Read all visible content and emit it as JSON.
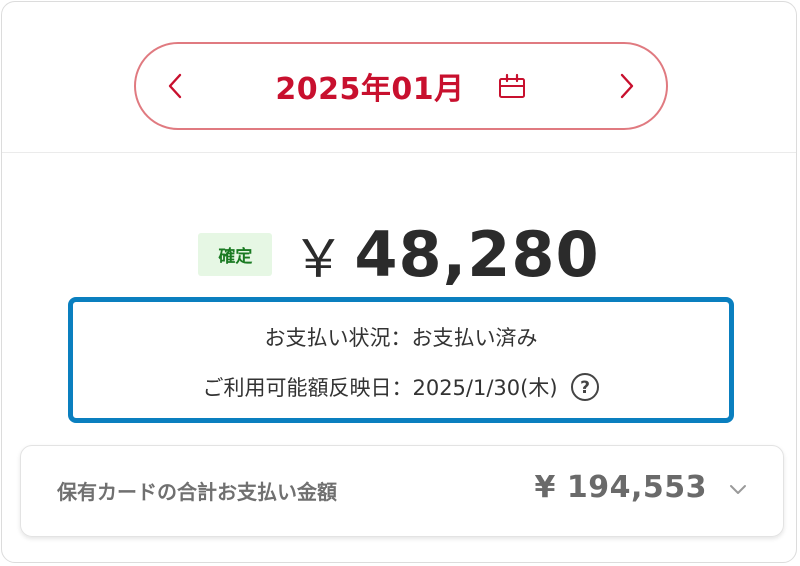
{
  "month_selector": {
    "label": "2025年01月",
    "prev_icon": "chevron-left-icon",
    "next_icon": "chevron-right-icon",
    "calendar_icon": "calendar-icon",
    "accent_color": "#c8102e"
  },
  "payment": {
    "badge": "確定",
    "currency": "￥",
    "amount": "48,280",
    "status_line": "お支払い状況：お支払い済み",
    "available_line": "ご利用可能額反映日：2025/1/30(木)",
    "help_icon": "question-circle-icon"
  },
  "total": {
    "label": "保有カードの合計お支払い金額",
    "amount": "¥ 194,553",
    "expand_icon": "chevron-down-icon"
  },
  "colors": {
    "highlight_border": "#0a7fbf",
    "badge_bg": "#e6f7e4",
    "badge_text": "#1a7a22"
  }
}
